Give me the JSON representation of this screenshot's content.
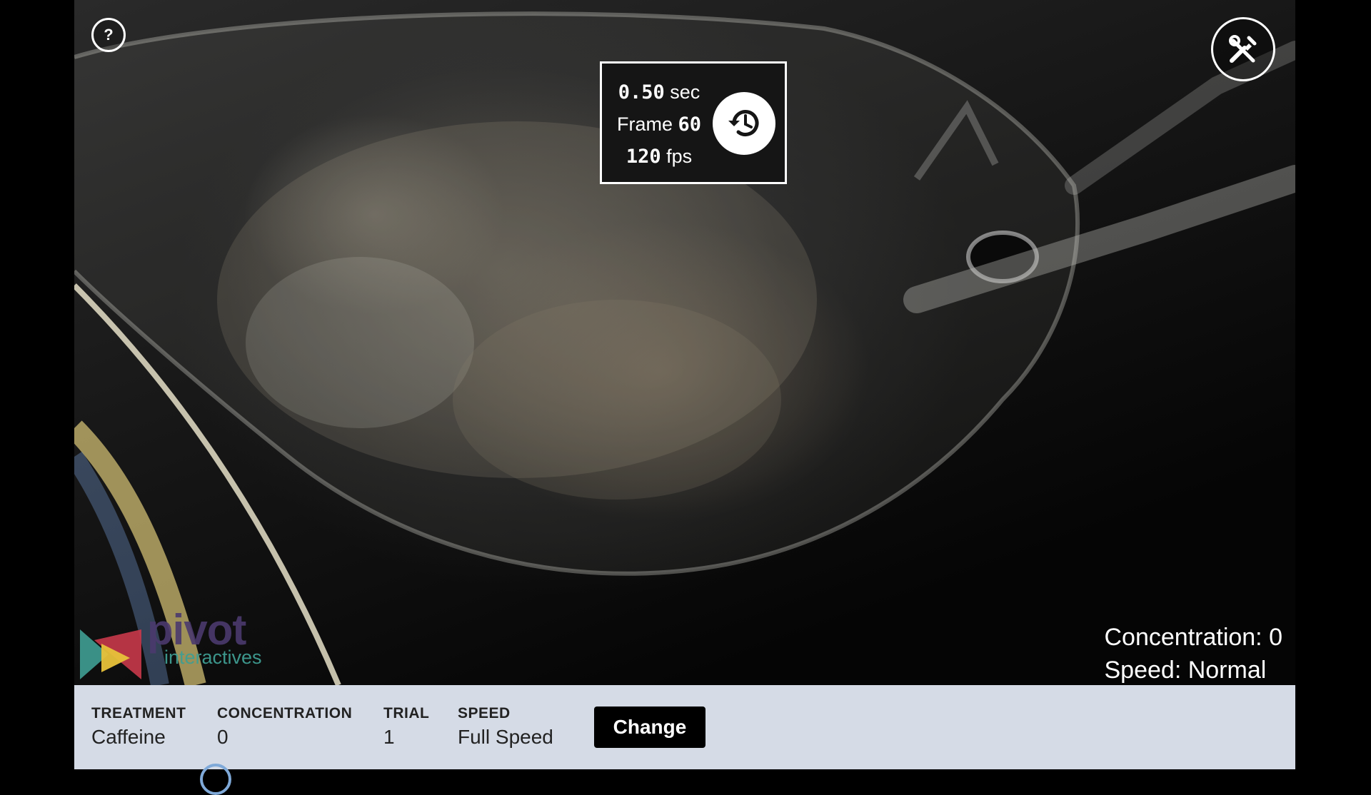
{
  "help": {
    "label": "?"
  },
  "timer": {
    "seconds_value": "0.50",
    "seconds_unit": "sec",
    "frame_label": "Frame",
    "frame_value": "60",
    "fps_value": "120",
    "fps_unit": "fps"
  },
  "overlay": {
    "concentration_text": "Concentration: 0",
    "speed_text": "Speed: Normal"
  },
  "logo": {
    "word": "pivot",
    "sub": "interactives"
  },
  "controls": {
    "fields": [
      {
        "label": "TREATMENT",
        "value": "Caffeine"
      },
      {
        "label": "CONCENTRATION",
        "value": "0"
      },
      {
        "label": "TRIAL",
        "value": "1"
      },
      {
        "label": "SPEED",
        "value": "Full Speed"
      }
    ],
    "change_label": "Change"
  },
  "icons": {
    "tools": "wrench-screwdriver-icon",
    "reset": "history-reset-icon",
    "help": "question-icon"
  },
  "colors": {
    "bar_background": "#d5dbe6",
    "button_background": "#000000",
    "logo_purple": "#4b3a6e",
    "logo_teal": "#3f9e93"
  }
}
